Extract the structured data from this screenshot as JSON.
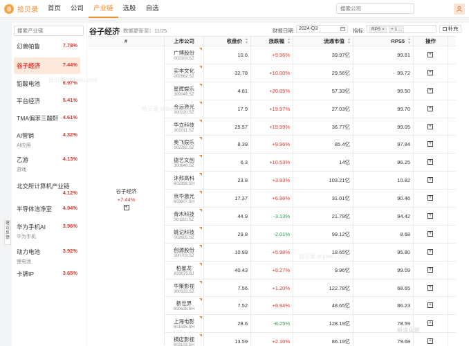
{
  "app": {
    "logo_text": "拾贝录"
  },
  "nav": [
    "首页",
    "公司",
    "产业链",
    "选股",
    "自选"
  ],
  "top_search_placeholder": "搜索公司",
  "sidebar": {
    "search_placeholder": "搜索产业链",
    "items": [
      {
        "name": "幻兽帕鲁",
        "pct": "7.78%",
        "sub": ""
      },
      {
        "name": "谷子经济",
        "pct": "7.44%",
        "sub": ""
      },
      {
        "name": "铅酸电池",
        "pct": "6.97%",
        "sub": ""
      },
      {
        "name": "平台经济",
        "pct": "5.41%",
        "sub": ""
      },
      {
        "name": "TMA偏苯三酸酐",
        "pct": "4.61%",
        "sub": ""
      },
      {
        "name": "AI营销",
        "pct": "4.32%",
        "sub": "AI应用"
      },
      {
        "name": "乙游",
        "pct": "4.13%",
        "sub": "游戏"
      },
      {
        "name": "北交所计算机产业链",
        "pct": "4.12%",
        "sub": ""
      },
      {
        "name": "半导体洁净室",
        "pct": "4.04%",
        "sub": ""
      },
      {
        "name": "华为手机AI",
        "pct": "3.96%",
        "sub": "华为手机"
      },
      {
        "name": "动力电池",
        "pct": "3.92%",
        "sub": "锂电池"
      },
      {
        "name": "卡牌IP",
        "pct": "3.65%",
        "sub": ""
      }
    ]
  },
  "feedback": "建议反馈",
  "main": {
    "title": "谷子经济",
    "update_label": "数据更新至：",
    "update_date": "11/25",
    "period_label": "财报日期:",
    "period_value": "2024-Q3",
    "metric_label": "指标:",
    "metric_tags": [
      "RPS ×",
      "+ 1 ..."
    ],
    "fill_label": "补充"
  },
  "table": {
    "headers": [
      "#",
      "上市公司",
      "收盘价",
      "涨跌幅",
      "流通市值",
      "RPS5",
      "操作"
    ],
    "group": {
      "name": "谷子经济",
      "pct": "+7.44%"
    },
    "rows": [
      {
        "name": "广博股份",
        "code": "002103.SZ",
        "price": "10.6",
        "chg": "+9.96%",
        "cap": "39.97亿",
        "rps": "99.61"
      },
      {
        "name": "实丰文化",
        "code": "002862.SZ",
        "price": "32.78",
        "chg": "+10.00%",
        "cap": "29.56亿",
        "rps": "99.72"
      },
      {
        "name": "星辉娱乐",
        "code": "300043.SZ",
        "price": "4.61",
        "chg": "+20.05%",
        "cap": "57.33亿",
        "rps": "99.50"
      },
      {
        "name": "金运激光",
        "code": "300220.SZ",
        "price": "17.9",
        "chg": "+19.97%",
        "cap": "27.03亿",
        "rps": "99.70"
      },
      {
        "name": "华立科技",
        "code": "301011.SZ",
        "price": "25.57",
        "chg": "+19.99%",
        "cap": "36.77亿",
        "rps": "99.05"
      },
      {
        "name": "奥飞娱乐",
        "code": "002292.SZ",
        "price": "8.39",
        "chg": "+9.96%",
        "cap": "85.4亿",
        "rps": "97.84"
      },
      {
        "name": "德艺文创",
        "code": "300640.SZ",
        "price": "6.3",
        "chg": "+10.53%",
        "cap": "14亿",
        "rps": "96.25"
      },
      {
        "name": "沐邦高科",
        "code": "603398.SH",
        "price": "23.8",
        "chg": "+3.93%",
        "cap": "103.21亿",
        "rps": "10.82"
      },
      {
        "name": "京华激光",
        "code": "603607.SH",
        "price": "17.37",
        "chg": "+6.96%",
        "cap": "31.01亿",
        "rps": "90.46"
      },
      {
        "name": "青木科技",
        "code": "301110.SZ",
        "price": "44.9",
        "chg": "-3.13%",
        "cap": "21.79亿",
        "rps": "94.42"
      },
      {
        "name": "姚记科技",
        "code": "002605.SZ",
        "price": "29.8",
        "chg": "-2.01%",
        "cap": "99.12亿",
        "rps": "8.68"
      },
      {
        "name": "创源股份",
        "code": "300703.SZ",
        "price": "10.99",
        "chg": "+5.98%",
        "cap": "18.65亿",
        "rps": "95.80"
      },
      {
        "name": "柏星龙",
        "code": "833075.BJ",
        "price": "40.43",
        "chg": "+9.27%",
        "cap": "9.96亿",
        "rps": "99.09"
      },
      {
        "name": "华策影视",
        "code": "300133.SZ",
        "price": "7.56",
        "chg": "+1.20%",
        "cap": "122.78亿",
        "rps": "68.65"
      },
      {
        "name": "新世界",
        "code": "600628.SH",
        "price": "7.52",
        "chg": "+9.94%",
        "cap": "48.65亿",
        "rps": "86.23"
      },
      {
        "name": "上海电影",
        "code": "601595.SH",
        "price": "28.6",
        "chg": "-8.25%",
        "cap": "128.19亿",
        "rps": "78.59"
      },
      {
        "name": "横店影视",
        "code": "603103.SH",
        "price": "13.59",
        "chg": "+2.10%",
        "cap": "86.19亿",
        "rps": "79.68"
      }
    ]
  },
  "watermark": "拾贝录 shibeilu.com",
  "corner_watermark": "新浪众测"
}
